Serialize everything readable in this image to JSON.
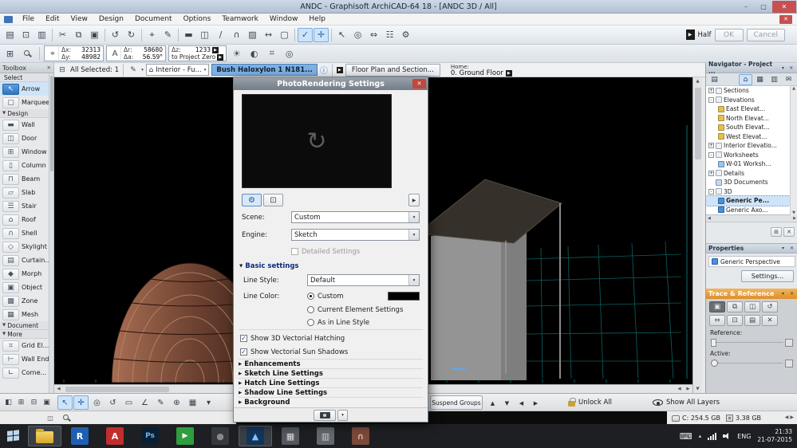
{
  "colors": {
    "accent_blue": "#2f74c0",
    "selection_fill": "#cfe4f8",
    "selected_object_blue": "#7fb0e2",
    "trace_header_orange": "#e69a33",
    "dialog_title_gray": "#7a828c",
    "viewport_background": "#000000",
    "teal_grid": "#0d6b6b",
    "dome_brown": "#8a5742",
    "roof_dark_brown": "#332d26",
    "wall_gray": "#8d8d8d",
    "taskbar_dark": "#1d1f22",
    "close_button_red": "#c75050",
    "elevation_icon_yellow": "#e2c24e",
    "camera_icon_blue": "#4a90d8"
  },
  "glyphs": {
    "caret": "▾",
    "right": "▶",
    "left": "◀",
    "up": "▲",
    "down": "▼",
    "info": "ⓘ",
    "house": "⌂",
    "keyboard": "⌨",
    "tray_up": "▴",
    "collapse": "⊟",
    "pen": "✎",
    "camera": "◎",
    "sun": "☀",
    "half_shadow": "◐",
    "grid": "⊞",
    "hash": "⌗",
    "check": "✓",
    "x": "✕",
    "target": "⌖",
    "pane": "◫"
  },
  "titlebar": {
    "title": "ANDC - Graphisoft ArchiCAD-64 18 - [ANDC 3D / All]",
    "minimize_glyph": "–",
    "maximize_glyph": "▢",
    "close_glyph": "✕"
  },
  "menubar": {
    "items": [
      "File",
      "Edit",
      "View",
      "Design",
      "Document",
      "Options",
      "Teamwork",
      "Window",
      "Help"
    ],
    "mdi_close_glyph": "✕"
  },
  "toolbar_main": {
    "icons": [
      {
        "name": "open-project-icon",
        "glyph": "▤"
      },
      {
        "name": "save-icon",
        "glyph": "⊡"
      },
      {
        "name": "print-icon",
        "glyph": "▥"
      },
      {
        "name": "cut-icon",
        "glyph": "✂"
      },
      {
        "name": "copy-icon",
        "glyph": "⧉"
      },
      {
        "name": "paste-icon",
        "glyph": "▣"
      },
      {
        "name": "undo-icon",
        "glyph": "↺"
      },
      {
        "name": "redo-icon",
        "glyph": "↻"
      },
      {
        "name": "find-select-icon",
        "glyph": "⌖"
      },
      {
        "name": "pen-icon",
        "glyph": "✎"
      },
      {
        "name": "wall-tool-icon",
        "glyph": "▬"
      },
      {
        "name": "door-tool-icon",
        "glyph": "◫"
      },
      {
        "name": "line-tool-icon",
        "glyph": "∕"
      },
      {
        "name": "arc-tool-icon",
        "glyph": "∩"
      },
      {
        "name": "fill-tool-icon",
        "glyph": "▨"
      },
      {
        "name": "dimension-icon",
        "glyph": "↔"
      },
      {
        "name": "marquee-icon",
        "glyph": "▢"
      },
      {
        "name": "check-suggest-icon",
        "glyph": "✓"
      },
      {
        "name": "sketch-pen-icon",
        "glyph": "✛"
      },
      {
        "name": "arrow-cursor-icon",
        "glyph": "↖"
      },
      {
        "name": "orbit-icon",
        "glyph": "◎"
      },
      {
        "name": "mirror-icon",
        "glyph": "⇔"
      },
      {
        "name": "layers-icon",
        "glyph": "☷"
      },
      {
        "name": "settings-gear-icon",
        "glyph": "⚙"
      }
    ],
    "half_label": "Half",
    "ok_label": "OK",
    "cancel_label": "Cancel"
  },
  "coordinates": {
    "dx_label": "Δx:",
    "dx_value": "32313",
    "dy_label": "Δy:",
    "dy_value": "48982",
    "dr_label": "Δr:",
    "dr_value": "58680",
    "da_label": "Δa:",
    "da_value": "56.59°",
    "dz_label": "Δz:",
    "dz_value": "1233",
    "reference_label": "to Project Zero",
    "angle_icon_glyph": "A"
  },
  "infobar": {
    "selection_status": "All Selected: 1",
    "favorites_value": "Interior - Fu...",
    "selected_object": "Bush Haloxylon 1 N181...",
    "floor_plan_button": "Floor Plan and Section...",
    "home_label": "Home:",
    "home_value": "0. Ground Floor"
  },
  "toolbox": {
    "title": "Toolbox",
    "groups": [
      {
        "label": "Select",
        "arrow": ""
      },
      {
        "label": "Design",
        "arrow": "▼"
      },
      {
        "label": "Document",
        "arrow": "▼"
      },
      {
        "label": "More",
        "arrow": "▼"
      }
    ],
    "select_items": [
      {
        "label": "Arrow",
        "glyph": "↖"
      },
      {
        "label": "Marquee",
        "glyph": "▢"
      }
    ],
    "design_items": [
      {
        "label": "Wall",
        "glyph": "▬"
      },
      {
        "label": "Door",
        "glyph": "◫"
      },
      {
        "label": "Window",
        "glyph": "⊞"
      },
      {
        "label": "Column",
        "glyph": "▯"
      },
      {
        "label": "Beam",
        "glyph": "⊓"
      },
      {
        "label": "Slab",
        "glyph": "▱"
      },
      {
        "label": "Stair",
        "glyph": "☰"
      },
      {
        "label": "Roof",
        "glyph": "⌂"
      },
      {
        "label": "Shell",
        "glyph": "∩"
      },
      {
        "label": "Skylight",
        "glyph": "◇"
      },
      {
        "label": "Curtain...",
        "glyph": "▤"
      },
      {
        "label": "Morph",
        "glyph": "◆"
      },
      {
        "label": "Object",
        "glyph": "▣"
      },
      {
        "label": "Zone",
        "glyph": "▩"
      },
      {
        "label": "Mesh",
        "glyph": "▦"
      }
    ],
    "more_items": [
      {
        "label": "Grid El...",
        "glyph": "⌗"
      },
      {
        "label": "Wall End",
        "glyph": "⊢"
      },
      {
        "label": "Corne...",
        "glyph": "∟"
      }
    ]
  },
  "dialog": {
    "title": "PhotoRendering Settings",
    "close_glyph": "✕",
    "refresh_glyph": "↻",
    "settings_tab_glyph": "⚙",
    "size_tab_glyph": "⊡",
    "expand_glyph": "▶",
    "scene_label": "Scene:",
    "scene_value": "Custom",
    "engine_label": "Engine:",
    "engine_value": "Sketch",
    "detailed_settings_label": "Detailed Settings",
    "basic_settings_label": "Basic settings",
    "line_style_label": "Line Style:",
    "line_style_value": "Default",
    "line_color_label": "Line Color:",
    "radio_custom": "Custom",
    "radio_current_element": "Current Element Settings",
    "radio_as_in_line_style": "As in Line Style",
    "check_hatching": "Show 3D Vectorial Hatching",
    "check_shadows": "Show Vectorial Sun Shadows",
    "sections": [
      "Enhancements",
      "Sketch Line Settings",
      "Hatch Line Settings",
      "Shadow Line Settings",
      "Background"
    ],
    "line_color_value": "#000000"
  },
  "navigator": {
    "title": "Navigator - Project ...",
    "icons": [
      {
        "name": "project-chooser-icon",
        "glyph": "▤"
      },
      {
        "name": "project-map-icon",
        "glyph": "⌂"
      },
      {
        "name": "view-map-icon",
        "glyph": "▦"
      },
      {
        "name": "layout-book-icon",
        "glyph": "▥"
      },
      {
        "name": "publisher-icon",
        "glyph": "✉"
      }
    ],
    "tree": [
      {
        "label": "Sections",
        "expand": "+"
      },
      {
        "label": "Elevations",
        "expand": "-"
      },
      {
        "label": "East Elevat..."
      },
      {
        "label": "North Elevat..."
      },
      {
        "label": "South Elevat..."
      },
      {
        "label": "West Elevat..."
      },
      {
        "label": "Interior Elevatio...",
        "expand": "+"
      },
      {
        "label": "Worksheets",
        "expand": "-"
      },
      {
        "label": "W-01 Worksh..."
      },
      {
        "label": "Details",
        "expand": "+"
      },
      {
        "label": "3D Documents"
      },
      {
        "label": "3D",
        "expand": "-"
      },
      {
        "label": "Generic Pe..."
      },
      {
        "label": "Generic Axo..."
      }
    ]
  },
  "properties_panel": {
    "title": "Properties",
    "item_label": "Generic Perspective",
    "settings_button": "Settings..."
  },
  "trace_panel": {
    "title": "Trace & Reference",
    "row1_icons": [
      {
        "name": "trace-toggle-icon",
        "glyph": "▣"
      },
      {
        "name": "pick-reference-icon",
        "glyph": "⧉"
      },
      {
        "name": "switch-reference-icon",
        "glyph": "◫"
      },
      {
        "name": "rebuild-icon",
        "glyph": "↺"
      }
    ],
    "row2_icons": [
      {
        "name": "swap-icon",
        "glyph": "⇔"
      },
      {
        "name": "move-reference-icon",
        "glyph": "⊡"
      },
      {
        "name": "splitter-icon",
        "glyph": "▤"
      },
      {
        "name": "remove-icon",
        "glyph": "✕"
      }
    ],
    "reference_label": "Reference:",
    "active_label": "Active:"
  },
  "bottom_tools": {
    "mini_icons": [
      {
        "name": "pane-left-icon",
        "glyph": "◧"
      },
      {
        "name": "pane-grid-icon",
        "glyph": "⊞"
      },
      {
        "name": "pane-bottom-icon",
        "glyph": "⊟"
      },
      {
        "name": "pane-full-icon",
        "glyph": "▣"
      }
    ],
    "tools": [
      {
        "name": "select-arrow-icon",
        "glyph": "↖"
      },
      {
        "name": "pan-icon",
        "glyph": "✛"
      },
      {
        "name": "orbit-icon",
        "glyph": "◎"
      },
      {
        "name": "previous-view-icon",
        "glyph": "↺"
      },
      {
        "name": "fit-view-icon",
        "glyph": "▭"
      },
      {
        "name": "angle-icon",
        "glyph": "∠"
      },
      {
        "name": "markup-pen-icon",
        "glyph": "✎"
      },
      {
        "name": "add-view-icon",
        "glyph": "⊕"
      },
      {
        "name": "mesh-display-icon",
        "glyph": "▦"
      },
      {
        "name": "more-options-icon",
        "glyph": "▾"
      }
    ]
  },
  "bottom_bar": {
    "suspend_groups": "Suspend Groups",
    "unlock_all": "Unlock All",
    "show_all_layers": "Show All Layers"
  },
  "status_bar": {
    "disk_space": "C: 254.5 GB",
    "memory": "3.38 GB"
  },
  "taskbar": {
    "apps": [
      {
        "name": "app-r",
        "glyph": "R",
        "style": "background:#1e5fb4;color:#ffffff"
      },
      {
        "name": "adobe-reader",
        "glyph": "A",
        "style": "background:#c22d2d;color:#ffffff"
      },
      {
        "name": "photoshop",
        "glyph": "Ps",
        "style": "background:#0a1f33;color:#6ab8f0;font-size:9px"
      },
      {
        "name": "green-app",
        "glyph": "▶",
        "style": "background:#2f9e3f;color:#ffffff;font-size:9px"
      },
      {
        "name": "dark-app",
        "glyph": "●",
        "style": "background:#35383c;color:#888888"
      },
      {
        "name": "archicad",
        "glyph": "▲",
        "style": "background:#12355e;color:#7fc4ff"
      },
      {
        "name": "calculator",
        "glyph": "▦",
        "style": "background:#54585e;color:#dddddd"
      },
      {
        "name": "utility-app",
        "glyph": "▥",
        "style": "background:#64686e;color:#cccccc"
      },
      {
        "name": "render-app",
        "glyph": "∩",
        "style": "background:#7a4a3a;color:#e0b090"
      }
    ],
    "language": "ENG",
    "time": "21:33",
    "date": "21-07-2015"
  }
}
